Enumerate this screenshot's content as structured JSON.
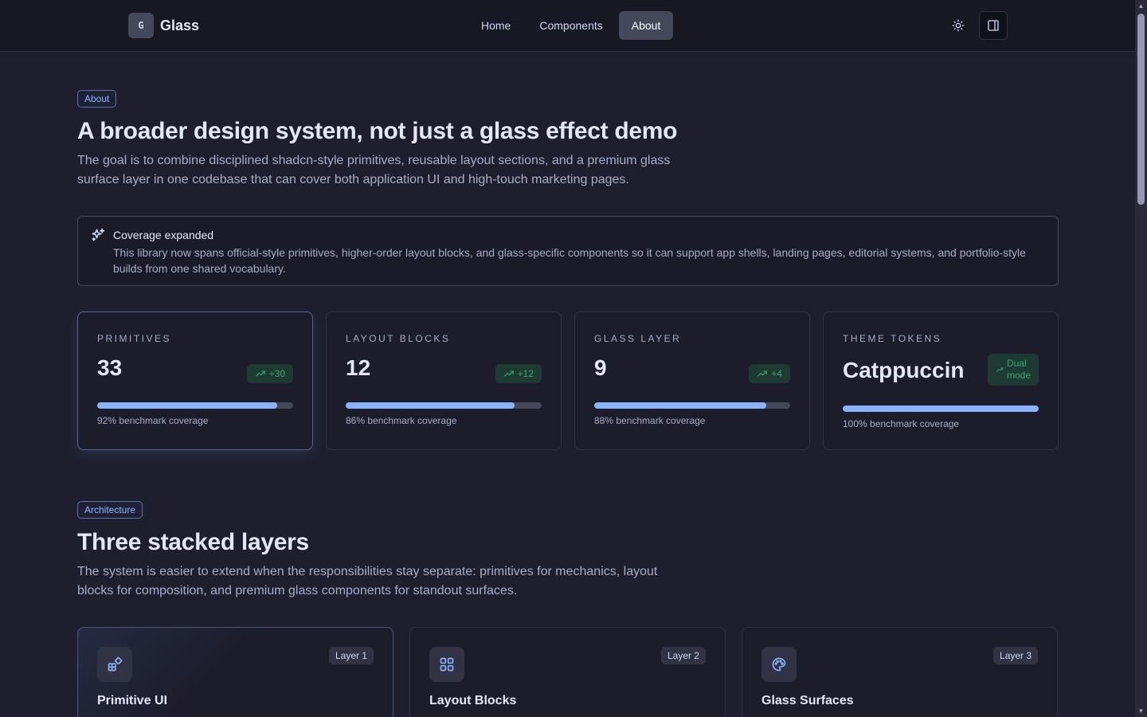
{
  "brand": {
    "logo_letter": "G",
    "name": "Glass"
  },
  "nav": {
    "links": [
      {
        "label": "Home",
        "active": false
      },
      {
        "label": "Components",
        "active": false
      },
      {
        "label": "About",
        "active": true
      }
    ],
    "actions": [
      {
        "icon": "sun-icon",
        "label": "Toggle theme"
      },
      {
        "icon": "sidebar-panel-icon",
        "label": "Toggle sidebar"
      }
    ]
  },
  "about": {
    "badge": "About",
    "title": "A broader design system, not just a glass effect demo",
    "lead": "The goal is to combine disciplined shadcn-style primitives, reusable layout sections, and a premium glass surface layer in one codebase that can cover both application UI and high-touch marketing pages."
  },
  "alert": {
    "icon": "sparkles-icon",
    "title": "Coverage expanded",
    "description": "This library now spans official-style primitives, higher-order layout blocks, and glass-specific components so it can support app shells, landing pages, editorial systems, and portfolio-style builds from one shared vocabulary."
  },
  "stats": [
    {
      "label": "PRIMITIVES",
      "value": "33",
      "delta": "+30",
      "progress_percent": 92,
      "caption": "92% benchmark coverage"
    },
    {
      "label": "LAYOUT BLOCKS",
      "value": "12",
      "delta": "+12",
      "progress_percent": 86,
      "caption": "86% benchmark coverage"
    },
    {
      "label": "GLASS LAYER",
      "value": "9",
      "delta": "+4",
      "progress_percent": 88,
      "caption": "88% benchmark coverage"
    },
    {
      "label": "THEME TOKENS",
      "value": "Catppuccin",
      "delta_line1": "Dual",
      "delta_line2": "mode",
      "progress_percent": 100,
      "caption": "100% benchmark coverage"
    }
  ],
  "architecture": {
    "badge": "Architecture",
    "title": "Three stacked layers",
    "lead": "The system is easier to extend when the responsibilities stay separate: primitives for mechanics, layout blocks for composition, and premium glass components for standout surfaces."
  },
  "layers": [
    {
      "tag": "Layer 1",
      "title": "Primitive UI",
      "icon": "shapes-icon"
    },
    {
      "tag": "Layer 2",
      "title": "Layout Blocks",
      "icon": "grid-icon"
    },
    {
      "tag": "Layer 3",
      "title": "Glass Surfaces",
      "icon": "palette-icon"
    }
  ],
  "colors": {
    "background": "#1e1e2e",
    "navbar": "#181825",
    "accent": "#89b4fa",
    "success": "#40a070",
    "text": "#cdd6f4",
    "muted": "#a6adc8"
  }
}
